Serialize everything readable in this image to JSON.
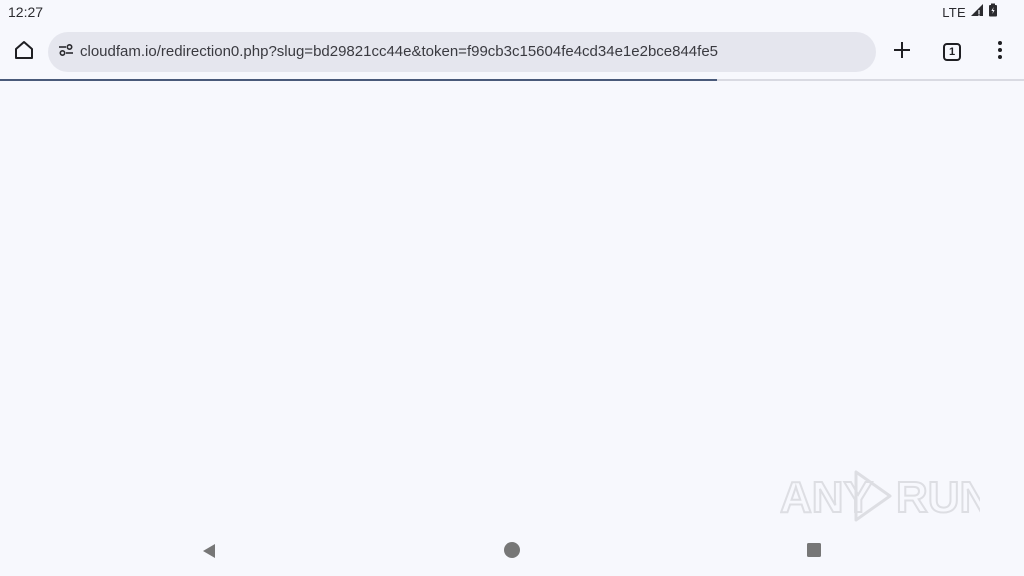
{
  "status_bar": {
    "time": "12:27",
    "network": "LTE",
    "icons": [
      "signal-icon",
      "battery-icon"
    ]
  },
  "toolbar": {
    "url": "cloudfam.io/redirection0.php?slug=bd29821cc44e&token=f99cb3c15604fe4cd34e1e2bce844fe5",
    "tab_count": "1",
    "icons": [
      "home-icon",
      "site-settings-icon",
      "plus-icon",
      "more-vert-icon"
    ]
  },
  "page_load": {
    "progress_fraction": 0.7
  },
  "watermark": {
    "text": "ANY RUN"
  },
  "navigation_bar": {
    "icons": [
      "back-icon",
      "home-circle-icon",
      "recents-icon"
    ]
  },
  "colors": {
    "background": "#f7f8fd",
    "omnibox": "#e5e6ee",
    "progress": "#4a5a7a",
    "icon_dark": "#1f1f23",
    "nav_icon": "#777777"
  }
}
